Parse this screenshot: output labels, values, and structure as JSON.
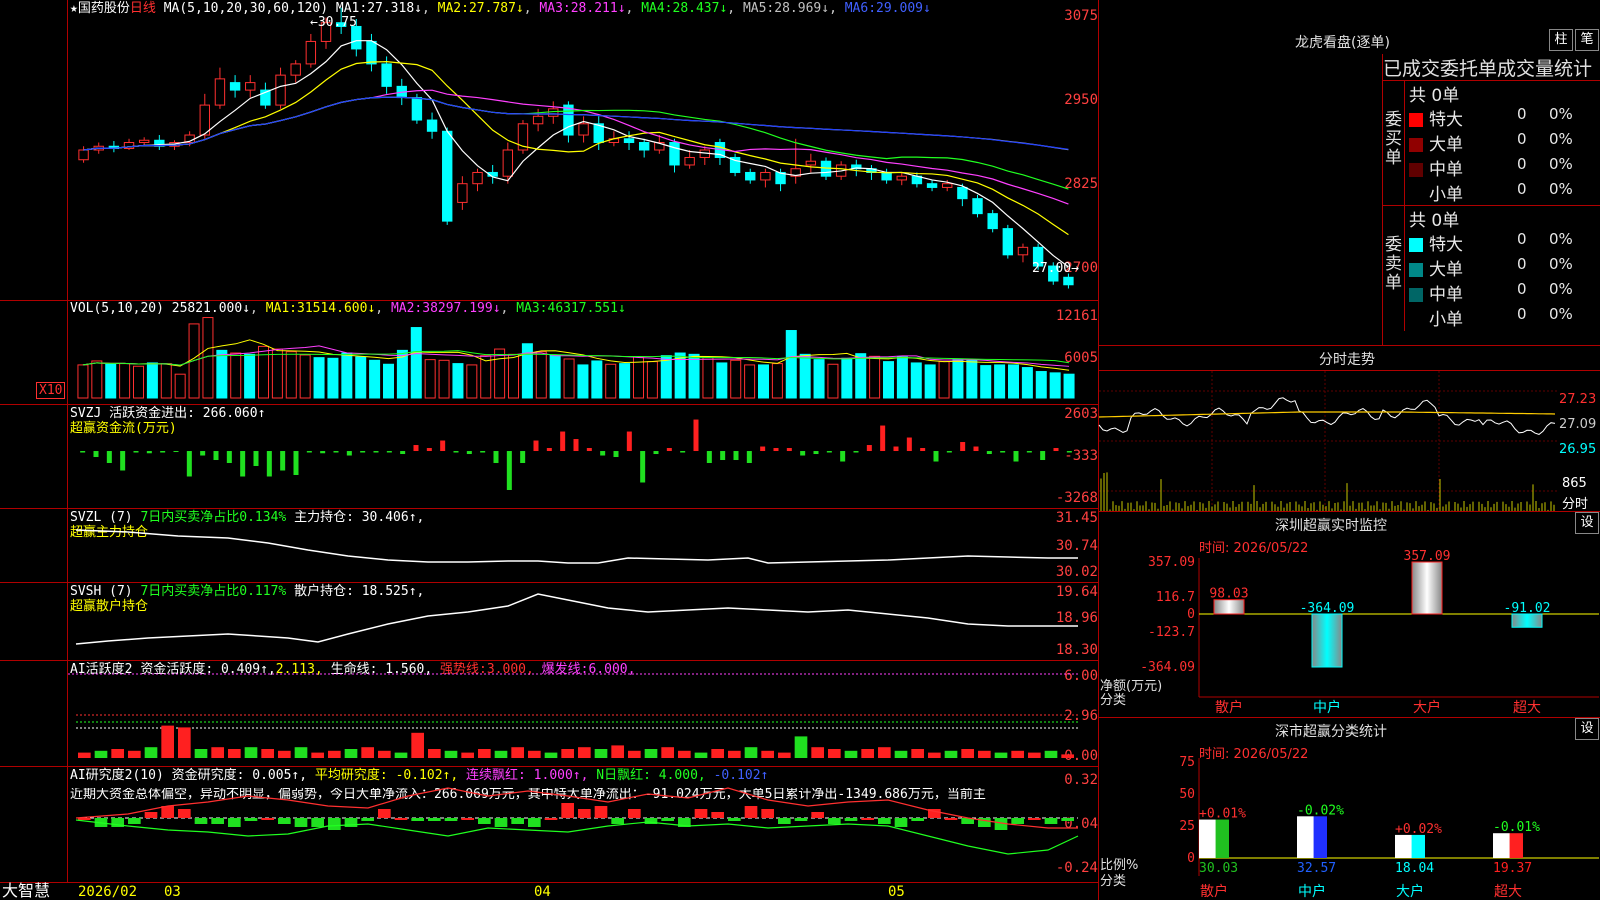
{
  "main_chart": {
    "stock_name": "国药股份",
    "period": "日线",
    "ma_params": "MA(5,10,20,30,60,120)",
    "ma_values": [
      {
        "name": "MA1",
        "value": "27.318↓",
        "color": "#ffffff"
      },
      {
        "name": "MA2",
        "value": "27.787↓",
        "color": "#ffff00"
      },
      {
        "name": "MA3",
        "value": "28.211↓",
        "color": "#ff40ff"
      },
      {
        "name": "MA4",
        "value": "28.437↓",
        "color": "#20ff20"
      },
      {
        "name": "MA5",
        "value": "28.969↓",
        "color": "#c0c0c0"
      },
      {
        "name": "MA6",
        "value": "29.009↓",
        "color": "#2040ff"
      }
    ],
    "y_ticks": [
      "3075",
      "2950",
      "2825",
      "2700"
    ],
    "high_label": "30.75",
    "low_label": "27.00"
  },
  "chart_data": [
    {
      "type": "candlestick",
      "title": "国药股份 日线",
      "ylim": [
        26.9,
        30.8
      ],
      "candles": [
        {
          "o": 28.72,
          "c": 28.85,
          "h": 28.9,
          "l": 28.68
        },
        {
          "o": 28.85,
          "c": 28.9,
          "h": 28.95,
          "l": 28.8
        },
        {
          "o": 28.9,
          "c": 28.87,
          "h": 28.97,
          "l": 28.82
        },
        {
          "o": 28.87,
          "c": 28.95,
          "h": 29.0,
          "l": 28.85
        },
        {
          "o": 28.95,
          "c": 28.98,
          "h": 29.02,
          "l": 28.9
        },
        {
          "o": 28.98,
          "c": 28.9,
          "h": 29.05,
          "l": 28.85
        },
        {
          "o": 28.9,
          "c": 28.95,
          "h": 28.98,
          "l": 28.85
        },
        {
          "o": 28.95,
          "c": 29.05,
          "h": 29.1,
          "l": 28.9
        },
        {
          "o": 29.05,
          "c": 29.45,
          "h": 29.6,
          "l": 29.0
        },
        {
          "o": 29.45,
          "c": 29.8,
          "h": 29.95,
          "l": 29.4
        },
        {
          "o": 29.75,
          "c": 29.65,
          "h": 29.85,
          "l": 29.55
        },
        {
          "o": 29.65,
          "c": 29.75,
          "h": 29.85,
          "l": 29.55
        },
        {
          "o": 29.65,
          "c": 29.45,
          "h": 29.75,
          "l": 29.4
        },
        {
          "o": 29.45,
          "c": 29.85,
          "h": 29.95,
          "l": 29.4
        },
        {
          "o": 29.85,
          "c": 30.0,
          "h": 30.05,
          "l": 29.75
        },
        {
          "o": 30.0,
          "c": 30.3,
          "h": 30.4,
          "l": 29.95
        },
        {
          "o": 30.3,
          "c": 30.55,
          "h": 30.62,
          "l": 30.2
        },
        {
          "o": 30.55,
          "c": 30.5,
          "h": 30.75,
          "l": 30.4
        },
        {
          "o": 30.5,
          "c": 30.2,
          "h": 30.6,
          "l": 30.1
        },
        {
          "o": 30.3,
          "c": 30.0,
          "h": 30.4,
          "l": 29.9
        },
        {
          "o": 30.0,
          "c": 29.7,
          "h": 30.1,
          "l": 29.6
        },
        {
          "o": 29.7,
          "c": 29.55,
          "h": 29.8,
          "l": 29.45
        },
        {
          "o": 29.55,
          "c": 29.25,
          "h": 29.6,
          "l": 29.2
        },
        {
          "o": 29.25,
          "c": 29.1,
          "h": 29.35,
          "l": 29.0
        },
        {
          "o": 29.1,
          "c": 27.9,
          "h": 29.15,
          "l": 27.85
        },
        {
          "o": 28.15,
          "c": 28.4,
          "h": 28.5,
          "l": 28.05
        },
        {
          "o": 28.4,
          "c": 28.55,
          "h": 28.6,
          "l": 28.3
        },
        {
          "o": 28.55,
          "c": 28.5,
          "h": 28.65,
          "l": 28.4
        },
        {
          "o": 28.5,
          "c": 28.85,
          "h": 28.95,
          "l": 28.4
        },
        {
          "o": 28.85,
          "c": 29.2,
          "h": 29.25,
          "l": 28.8
        },
        {
          "o": 29.2,
          "c": 29.3,
          "h": 29.4,
          "l": 29.1
        },
        {
          "o": 29.3,
          "c": 29.4,
          "h": 29.5,
          "l": 29.2
        },
        {
          "o": 29.45,
          "c": 29.05,
          "h": 29.5,
          "l": 28.95
        },
        {
          "o": 29.05,
          "c": 29.2,
          "h": 29.3,
          "l": 28.95
        },
        {
          "o": 29.2,
          "c": 28.95,
          "h": 29.3,
          "l": 28.85
        },
        {
          "o": 28.95,
          "c": 29.0,
          "h": 29.1,
          "l": 28.9
        },
        {
          "o": 29.0,
          "c": 28.95,
          "h": 29.1,
          "l": 28.85
        },
        {
          "o": 28.95,
          "c": 28.85,
          "h": 29.0,
          "l": 28.75
        },
        {
          "o": 28.85,
          "c": 28.95,
          "h": 29.05,
          "l": 28.8
        },
        {
          "o": 28.95,
          "c": 28.65,
          "h": 29.0,
          "l": 28.55
        },
        {
          "o": 28.65,
          "c": 28.75,
          "h": 28.85,
          "l": 28.6
        },
        {
          "o": 28.75,
          "c": 28.85,
          "h": 28.9,
          "l": 28.65
        },
        {
          "o": 28.95,
          "c": 28.75,
          "h": 29.0,
          "l": 28.65
        },
        {
          "o": 28.75,
          "c": 28.55,
          "h": 28.8,
          "l": 28.5
        },
        {
          "o": 28.55,
          "c": 28.45,
          "h": 28.6,
          "l": 28.4
        },
        {
          "o": 28.45,
          "c": 28.55,
          "h": 28.6,
          "l": 28.35
        },
        {
          "o": 28.55,
          "c": 28.4,
          "h": 28.6,
          "l": 28.3
        },
        {
          "o": 28.5,
          "c": 28.6,
          "h": 29.0,
          "l": 28.4
        },
        {
          "o": 28.65,
          "c": 28.7,
          "h": 28.8,
          "l": 28.55
        },
        {
          "o": 28.7,
          "c": 28.5,
          "h": 28.75,
          "l": 28.45
        },
        {
          "o": 28.5,
          "c": 28.65,
          "h": 28.7,
          "l": 28.45
        },
        {
          "o": 28.65,
          "c": 28.6,
          "h": 28.72,
          "l": 28.5
        },
        {
          "o": 28.6,
          "c": 28.55,
          "h": 28.65,
          "l": 28.45
        },
        {
          "o": 28.55,
          "c": 28.45,
          "h": 28.6,
          "l": 28.4
        },
        {
          "o": 28.45,
          "c": 28.5,
          "h": 28.55,
          "l": 28.38
        },
        {
          "o": 28.5,
          "c": 28.4,
          "h": 28.55,
          "l": 28.35
        },
        {
          "o": 28.4,
          "c": 28.35,
          "h": 28.45,
          "l": 28.3
        },
        {
          "o": 28.35,
          "c": 28.4,
          "h": 28.45,
          "l": 28.3
        },
        {
          "o": 28.35,
          "c": 28.2,
          "h": 28.4,
          "l": 28.1
        },
        {
          "o": 28.2,
          "c": 28.0,
          "h": 28.25,
          "l": 27.95
        },
        {
          "o": 28.0,
          "c": 27.8,
          "h": 28.05,
          "l": 27.75
        },
        {
          "o": 27.8,
          "c": 27.45,
          "h": 27.85,
          "l": 27.4
        },
        {
          "o": 27.45,
          "c": 27.55,
          "h": 27.6,
          "l": 27.35
        },
        {
          "o": 27.55,
          "c": 27.3,
          "h": 27.6,
          "l": 27.25
        },
        {
          "o": 27.3,
          "c": 27.1,
          "h": 27.35,
          "l": 27.05
        },
        {
          "o": 27.15,
          "c": 27.05,
          "h": 27.2,
          "l": 27.0
        }
      ]
    },
    {
      "type": "bar",
      "title": "VOL(5,10,20)",
      "ylim": [
        0,
        13000
      ],
      "values": [
        5000,
        5600,
        5100,
        5200,
        4800,
        5300,
        5200,
        3600,
        11200,
        12161,
        7200,
        6800,
        6600,
        7800,
        7400,
        7000,
        6500,
        6100,
        6000,
        6800,
        6200,
        5700,
        5100,
        7200,
        10650,
        5800,
        5700,
        5200,
        5000,
        6400,
        7400,
        6600,
        8200,
        7000,
        6500,
        5900,
        5000,
        5600,
        5100,
        5200,
        6200,
        5500,
        6400,
        6800,
        6600,
        6100,
        5300,
        5700,
        5000,
        5000,
        5200,
        10200,
        6600,
        5800,
        5100,
        6000,
        6700,
        6300,
        5500,
        6200,
        5300,
        5000,
        5500,
        5800,
        5700,
        4900,
        5000,
        5000,
        4600,
        4000,
        3800,
        3600
      ],
      "colors_up": "#ff3030",
      "colors_down": "#00ffff"
    },
    {
      "type": "bar",
      "title": "SVZJ 活跃资金进出",
      "ylim": [
        -3268,
        2603
      ],
      "values": [
        -100,
        -400,
        -800,
        -1300,
        -100,
        -150,
        -100,
        -50,
        -1700,
        -300,
        -600,
        -800,
        -1700,
        -1000,
        -1700,
        -1300,
        -1600,
        -100,
        -150,
        -100,
        -300,
        -100,
        -100,
        -100,
        -200,
        400,
        200,
        700,
        -100,
        -200,
        -100,
        -800,
        -2600,
        -800,
        700,
        200,
        1300,
        800,
        200,
        -300,
        -400,
        1300,
        -2100,
        -200,
        200,
        -100,
        2100,
        -800,
        -600,
        -600,
        -800,
        300,
        200,
        200,
        -300,
        -200,
        -100,
        -700,
        -100,
        400,
        1700,
        300,
        900,
        200,
        -700,
        -100,
        600,
        300,
        -200,
        -100,
        -700,
        -100,
        -600,
        200,
        -100
      ]
    }
  ],
  "vol_panel": {
    "title": "VOL(5,10,20)",
    "value": "25821.000↓",
    "ma_items": [
      {
        "name": "MA1",
        "value": "31514.600↓",
        "color": "#ffff00"
      },
      {
        "name": "MA2",
        "value": "38297.199↓",
        "color": "#ff40ff"
      },
      {
        "name": "MA3",
        "value": "46317.551↓",
        "color": "#20ff20"
      }
    ],
    "y_ticks": [
      "12161",
      "6005"
    ],
    "unit": "X10"
  },
  "svzj_panel": {
    "title": "SVZJ",
    "label": "活跃资金进出:",
    "value": "266.060↑",
    "subtitle": "超赢资金流(万元)",
    "y_ticks": [
      "2603",
      "-333",
      "-3268"
    ]
  },
  "svzl_panel": {
    "title": "SVZL (7)",
    "ratio_label": "7日内买卖净占比0.134%",
    "hold_label": "主力持仓:",
    "hold_value": "30.406↑,",
    "subtitle": "超赢主力持仓",
    "y_ticks": [
      "31.45",
      "30.74",
      "30.02"
    ]
  },
  "svsh_panel": {
    "title": "SVSH (7)",
    "ratio_label": "7日内买卖净占比0.117%",
    "hold_label": "散户持仓:",
    "hold_value": "18.525↑,",
    "subtitle": "超赢散户持仓",
    "y_ticks": [
      "19.64",
      "18.96",
      "18.30"
    ]
  },
  "ai_active_panel": {
    "title": "AI活跃度2",
    "label": "资金活跃度:",
    "v1": "0.409↑,",
    "v2": "2.113,",
    "life_label": "生命线:",
    "life_value": "1.560,",
    "strong_label": "强势线:",
    "strong_value": "3.000,",
    "burst_label": "爆发线:",
    "burst_value": "6.000,",
    "y_ticks": [
      "6.00",
      "2.96",
      "0.00"
    ]
  },
  "ai_research_panel": {
    "title": "AI研究度2(10)",
    "label": "资金研究度:",
    "value": "0.005↑,",
    "avg_label": "平均研究度:",
    "avg_value": "-0.102↑,",
    "cont_label": "连续飘红:",
    "cont_value": "1.000↑,",
    "n_label": "N日飘红:",
    "n_value": "4.000,",
    "last_value": "-0.102↑",
    "commentary": "近期大资金总体偏空，异动不明显，偏弱势，今日大单净流入：266.069万元，其中特大单净流出：-91.024万元，大单5日累计净出-1349.686万元，当前主",
    "y_ticks": [
      "0.32",
      "0.04",
      "-0.24"
    ]
  },
  "x_axis": {
    "labels": [
      "2026/02",
      "03",
      "04",
      "05"
    ]
  },
  "footer": {
    "brand": "大智慧"
  },
  "right_panel": {
    "dragon_title": "龙虎看盘(逐单)",
    "btn_bar": "柱",
    "btn_pen": "笔",
    "tabs": [
      "已成交委托单",
      "成交量统计"
    ],
    "buy_header": "共 0单",
    "buy_side_label": "委买单",
    "sell_header": "共 0单",
    "sell_side_label": "委卖单",
    "buy_rows": [
      {
        "name": "特大",
        "count": "0",
        "pct": "0%",
        "color": "#ff0000"
      },
      {
        "name": "大单",
        "count": "0",
        "pct": "0%",
        "color": "#900000"
      },
      {
        "name": "中单",
        "count": "0",
        "pct": "0%",
        "color": "#600000"
      },
      {
        "name": "小单",
        "count": "0",
        "pct": "0%",
        "color": "#000000"
      }
    ],
    "sell_rows": [
      {
        "name": "特大",
        "count": "0",
        "pct": "0%",
        "color": "#00ffff"
      },
      {
        "name": "大单",
        "count": "0",
        "pct": "0%",
        "color": "#008888"
      },
      {
        "name": "中单",
        "count": "0",
        "pct": "0%",
        "color": "#006666"
      },
      {
        "name": "小单",
        "count": "0",
        "pct": "0%",
        "color": "#000000"
      }
    ],
    "intraday_title": "分时走势",
    "intraday_ticks": [
      "27.23",
      "27.09",
      "26.95"
    ],
    "intraday_vol_tick": "865",
    "intraday_vol_label": "分时",
    "monitor_title": "深圳超赢实时监控",
    "monitor_btn": "设",
    "monitor_time": "时间: 2026/05/22",
    "monitor_y_ticks": [
      "357.09",
      "116.7",
      "0",
      "-123.7",
      "-364.09"
    ],
    "monitor_y_label": "净额(万元)",
    "monitor_x_label": "分类",
    "monitor_categories": [
      "散户",
      "中户",
      "大户",
      "超大"
    ],
    "monitor_values": [
      98.03,
      -364.09,
      357.09,
      -91.02
    ],
    "monitor_value_labels": [
      "98.03",
      "-364.09",
      "357.09",
      "-91.02"
    ],
    "stats_title": "深市超赢分类统计",
    "stats_btn": "设",
    "stats_time": "时间: 2026/05/22",
    "stats_y_ticks": [
      "75",
      "50",
      "25",
      "0"
    ],
    "stats_y_label": "比例%",
    "stats_x_label": "分类",
    "stats_categories": [
      "散户",
      "中户",
      "大户",
      "超大"
    ],
    "stats_values": [
      30.03,
      32.57,
      18.04,
      19.37
    ],
    "stats_value_labels": [
      "30.03",
      "32.57",
      "18.04",
      "19.37"
    ],
    "stats_change_labels": [
      "+0.01%",
      "-0.02%",
      "+0.02%",
      "-0.01%"
    ]
  }
}
